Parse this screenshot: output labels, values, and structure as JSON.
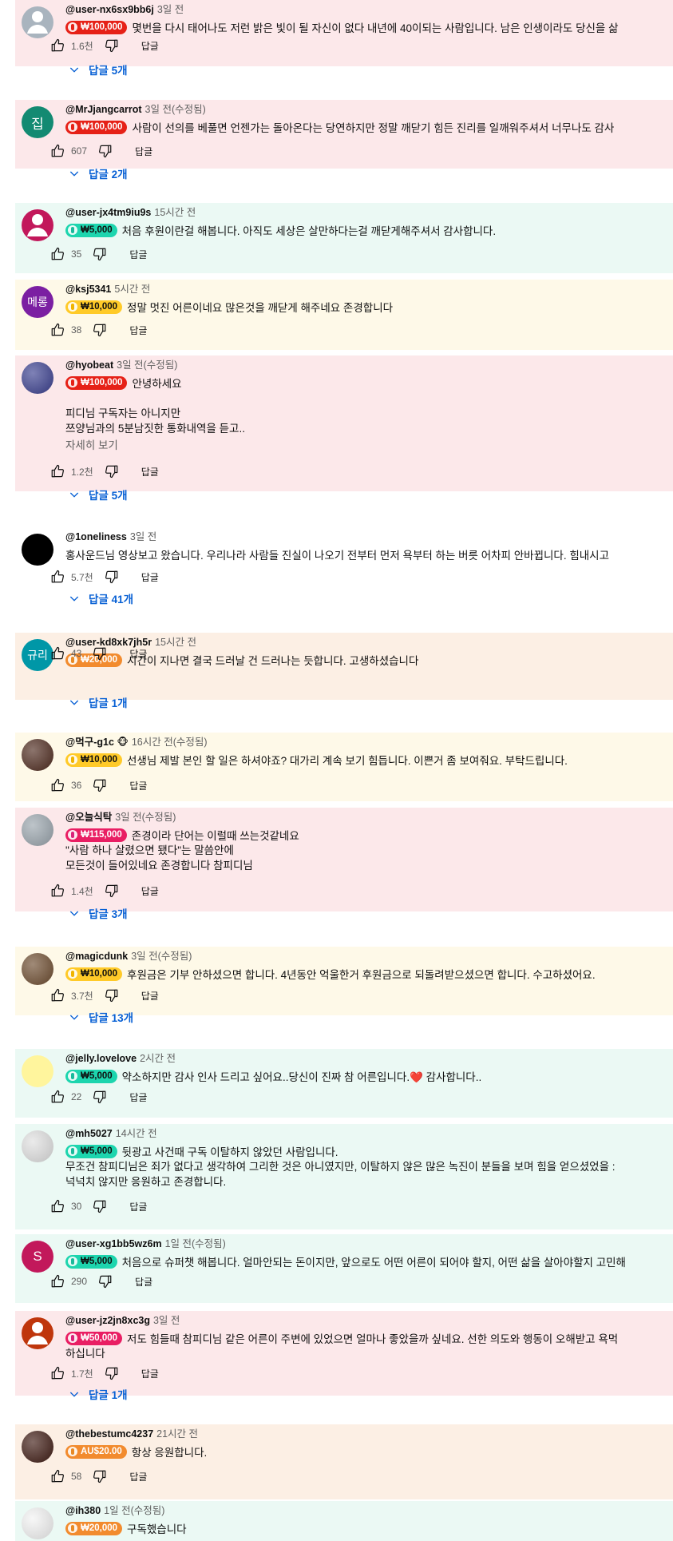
{
  "comments": [
    {
      "handle": "@user-nx6sx9bb6j",
      "time": "3일 전",
      "amount": "₩100,000",
      "pill": "red",
      "text": "몇번을 다시 태어나도 저런 밝은 빛이 될 자신이 없다 내년에 40이되는 사람입니다. 남은 인생이라도 당신을 삶",
      "likes": "1.6천",
      "reply": "답글",
      "replies": "답글 5개",
      "avatar": {
        "color": "#a9b4be",
        "kind": "person"
      }
    },
    {
      "handle": "@MrJjangcarrot",
      "time": "3일 전(수정됨)",
      "amount": "₩100,000",
      "pill": "red",
      "text": "사람이 선의를 베풀면 언젠가는 돌아온다는 당연하지만 정말 깨닫기 힘든 진리를 일깨워주셔서 너무나도 감사",
      "likes": "607",
      "reply": "답글",
      "replies": "답글 2개",
      "avatar": {
        "color": "#138a72",
        "kind": "letter",
        "letter": "집"
      }
    },
    {
      "handle": "@user-jx4tm9iu9s",
      "time": "15시간 전",
      "amount": "₩5,000",
      "pill": "mint",
      "text": "처음 후원이란걸 해봅니다. 아직도 세상은 살만하다는걸 깨닫게해주셔서 감사합니다.",
      "likes": "35",
      "reply": "답글",
      "avatar": {
        "color": "#c2185b",
        "kind": "person"
      }
    },
    {
      "handle": "@ksj5341",
      "time": "5시간 전",
      "amount": "₩10,000",
      "pill": "yellow",
      "text": "정말 멋진 어른이네요 많은것을 깨닫게 해주네요 존경합니다",
      "likes": "38",
      "reply": "답글",
      "avatar": {
        "color": "#7b1fa2",
        "kind": "letter",
        "letter": "메롱"
      }
    },
    {
      "handle": "@hyobeat",
      "time": "3일 전(수정됨)",
      "amount": "₩100,000",
      "pill": "red",
      "text": "안녕하세요",
      "extra": [
        "",
        "피디님 구독자는 아니지만",
        "쯔양님과의 5분남짓한 통화내역을 듣고.."
      ],
      "more": "자세히 보기",
      "likes": "1.2천",
      "reply": "답글",
      "replies": "답글 5개",
      "avatar": {
        "color": "#3a3f8f",
        "kind": "photo"
      }
    },
    {
      "handle": "@1oneliness",
      "time": "3일 전",
      "text": "홍사운드님 영상보고 왔습니다. 우리나라 사람들 진실이 나오기 전부터 먼저 욕부터 하는 버릇 어차피 안바뀝니다. 힘내시고",
      "likes": "5.7천",
      "reply": "답글",
      "replies": "답글 41개",
      "avatar": {
        "color": "#000000",
        "kind": "solid"
      }
    },
    {
      "handle": "@user-kd8xk7jh5r",
      "time": "15시간 전",
      "amount": "₩20,000",
      "pill": "orange",
      "text": "시간이 지나면 결국 드러날 건 드러나는 듯합니다. 고생하셨습니다",
      "likes": "43",
      "reply": "답글",
      "replies": "답글 1개",
      "avatar": {
        "color": "#0097a7",
        "kind": "letter",
        "letter": "규리"
      }
    },
    {
      "handle": "@먹구-g1c 🐵",
      "time": "16시간 전(수정됨)",
      "amount": "₩10,000",
      "pill": "yellow",
      "text": "선생님 제발 본인 할 일은 하셔야죠? 대가리 계속 보기 힘듭니다. 이쁜거 좀 보여줘요. 부탁드립니다.",
      "likes": "36",
      "reply": "답글",
      "avatar": {
        "color": "#4e2a1e",
        "kind": "photo"
      }
    },
    {
      "handle": "@오늘식탁",
      "time": "3일 전(수정됨)",
      "amount": "₩115,000",
      "pill": "magenta",
      "text": "존경이라 단어는 이럴때 쓰는것같네요",
      "extra": [
        "\"사람 하나 살렸으면 됐다\"는 말씀안에",
        "모든것이 들어있네요 존경합니다 참피디님"
      ],
      "likes": "1.4천",
      "reply": "답글",
      "replies": "답글 3개",
      "avatar": {
        "color": "#9aa5ad",
        "kind": "photo"
      }
    },
    {
      "handle": "@magicdunk",
      "time": "3일 전(수정됨)",
      "amount": "₩10,000",
      "pill": "yellow",
      "text": "후원금은 기부 안하셨으면 합니다. 4년동안 억울한거  후원금으로 되돌려받으셨으면 합니다. 수고하셨어요.",
      "likes": "3.7천",
      "reply": "답글",
      "replies": "답글 13개",
      "avatar": {
        "color": "#6d4c2f",
        "kind": "photo"
      }
    },
    {
      "handle": "@jelly.lovelove",
      "time": "2시간 전",
      "amount": "₩5,000",
      "pill": "mint",
      "text": "약소하지만 감사 인사 드리고 싶어요..당신이 진짜  참 어른입니다.❤️ 감사합니다..",
      "likes": "22",
      "reply": "답글",
      "avatar": {
        "color": "#fff59d",
        "kind": "solid"
      }
    },
    {
      "handle": "@mh5027",
      "time": "14시간 전",
      "amount": "₩5,000",
      "pill": "mint",
      "text": "뒷광고 사건때 구독 이탈하지 않았던 사람입니다.",
      "extra": [
        "무조건 참피디님은 죄가 없다고 생각하여 그리한 것은 아니였지만, 이탈하지 않은 많은 녹진이 분들을 보며 힘을 얻으셨었을 :",
        "넉넉치 않지만 응원하고 존경합니다."
      ],
      "likes": "30",
      "reply": "답글",
      "avatar": {
        "color": "#e0e0e0",
        "kind": "photo"
      }
    },
    {
      "handle": "@user-xg1bb5wz6m",
      "time": "1일 전(수정됨)",
      "amount": "₩5,000",
      "pill": "mint",
      "text": "처음으로 슈퍼챗 해봅니다. 얼마안되는 돈이지만, 앞으로도 어떤 어른이 되어야 할지, 어떤 삶을 살아야할지 고민해",
      "likes": "290",
      "reply": "답글",
      "avatar": {
        "color": "#c2185b",
        "kind": "letter",
        "letter": "S"
      }
    },
    {
      "handle": "@user-jz2jn8xc3g",
      "time": "3일 전",
      "amount": "₩50,000",
      "pill": "magenta",
      "text": "저도 힘들때 참피디님 같은 어른이 주변에 있었으면 얼마나 좋았을까 싶네요. 선한 의도와 행동이 오해받고 욕먹",
      "extra": [
        "하십니다"
      ],
      "likes": "1.7천",
      "reply": "답글",
      "replies": "답글 1개",
      "avatar": {
        "color": "#bf360c",
        "kind": "person"
      }
    },
    {
      "handle": "@thebestumc4237",
      "time": "21시간 전",
      "amount": "AU$20.00",
      "pill": "orange",
      "text": "항상 응원합니다.",
      "likes": "58",
      "reply": "답글",
      "avatar": {
        "color": "#3e1a12",
        "kind": "photo"
      }
    },
    {
      "handle": "@ih380",
      "time": "1일 전(수정됨)",
      "amount": "₩20,000",
      "pill": "orange",
      "text": "구독했습니다",
      "avatar": {
        "color": "#f3f3f3",
        "kind": "photo"
      }
    }
  ]
}
